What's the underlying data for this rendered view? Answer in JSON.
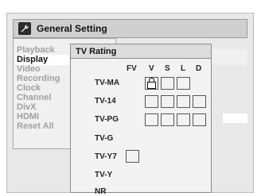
{
  "title": "General Setting",
  "menu": {
    "items": [
      {
        "label": "Playback",
        "selected": false
      },
      {
        "label": "Display",
        "selected": true
      },
      {
        "label": "Video",
        "selected": false
      },
      {
        "label": "Recording",
        "selected": false
      },
      {
        "label": "Clock",
        "selected": false
      },
      {
        "label": "Channel",
        "selected": false
      },
      {
        "label": "DivX",
        "selected": false
      },
      {
        "label": "HDMI",
        "selected": false
      },
      {
        "label": "Reset All",
        "selected": false
      }
    ]
  },
  "tv_rating": {
    "title": "TV Rating",
    "columns": [
      "FV",
      "V",
      "S",
      "L",
      "D"
    ],
    "rows": [
      {
        "label": "TV-MA",
        "locked_cell": "V"
      },
      {
        "label": "TV-14"
      },
      {
        "label": "TV-PG"
      },
      {
        "label": "TV-G"
      },
      {
        "label": "TV-Y7"
      },
      {
        "label": "TV-Y"
      },
      {
        "label": "NR"
      }
    ]
  },
  "icons": {
    "title": "wrench-icon",
    "locked_cell": "lock-icon",
    "submenu": "arrow-right-icon"
  }
}
